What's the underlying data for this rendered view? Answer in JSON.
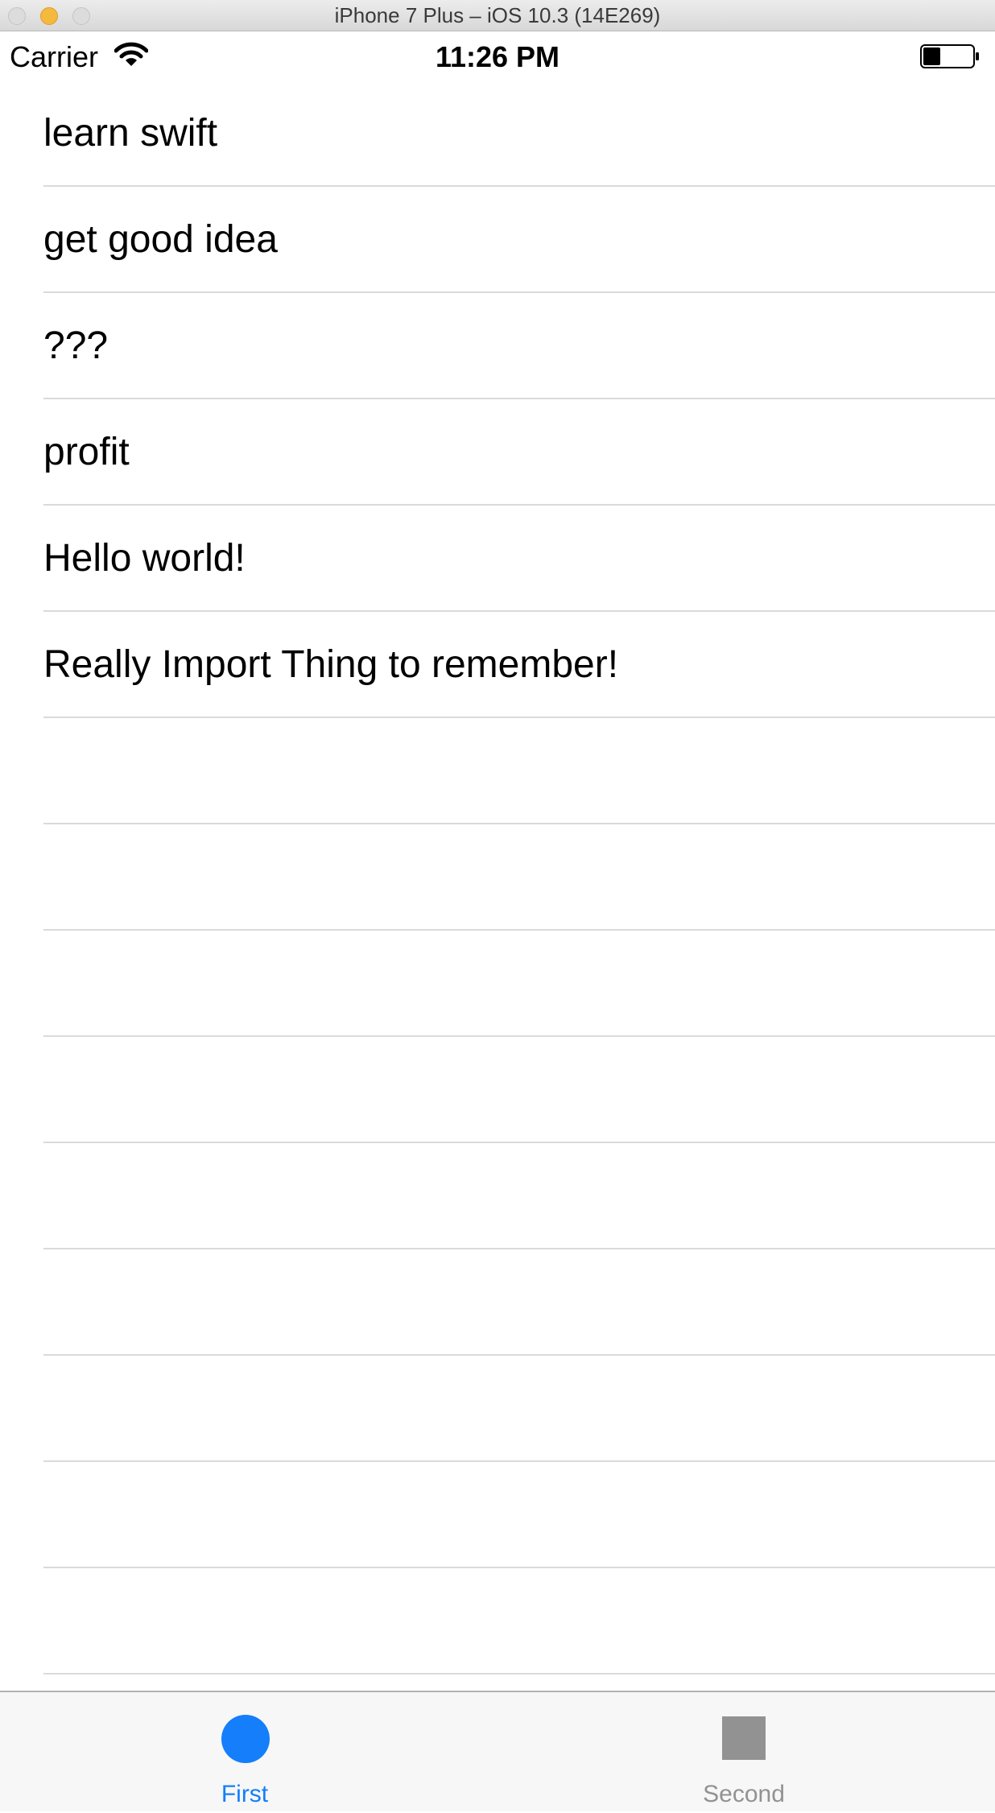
{
  "window": {
    "title": "iPhone 7 Plus – iOS 10.3 (14E269)"
  },
  "status_bar": {
    "carrier": "Carrier",
    "time": "11:26 PM",
    "wifi_icon": "wifi-icon",
    "battery_icon": "battery-icon",
    "battery_level": 0.35
  },
  "table": {
    "rows": [
      {
        "label": "learn swift"
      },
      {
        "label": "get good idea"
      },
      {
        "label": "???"
      },
      {
        "label": "profit"
      },
      {
        "label": "Hello world!"
      },
      {
        "label": "Really Import Thing to remember!"
      },
      {
        "label": ""
      },
      {
        "label": ""
      },
      {
        "label": ""
      },
      {
        "label": ""
      },
      {
        "label": ""
      },
      {
        "label": ""
      },
      {
        "label": ""
      },
      {
        "label": ""
      },
      {
        "label": ""
      }
    ]
  },
  "tab_bar": {
    "tabs": [
      {
        "label": "First",
        "icon": "circle-icon",
        "selected": true
      },
      {
        "label": "Second",
        "icon": "square-icon",
        "selected": false
      }
    ],
    "accent_color": "#147efb",
    "inactive_color": "#929292"
  }
}
